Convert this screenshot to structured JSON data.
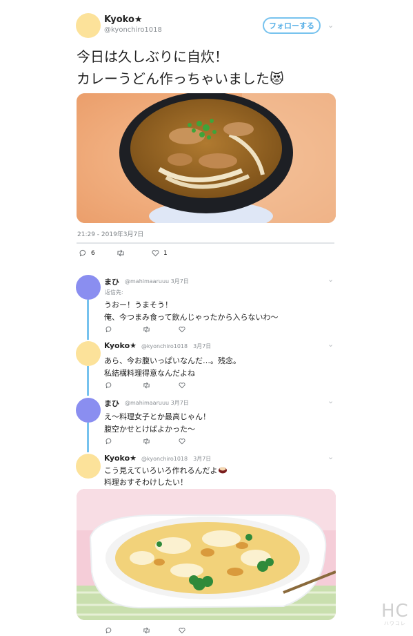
{
  "main_tweet": {
    "user_name": "Kyoko★",
    "handle": "@kyonchiro1018",
    "follow_label": "フォローする",
    "text_line1": "今日は久しぶりに自炊！",
    "text_line2": "カレーうどん作っちゃいました",
    "emoji": "😻",
    "timestamp": "21:29 - 2019年3月7日",
    "reply_count": "6",
    "like_count": "1"
  },
  "replies": [
    {
      "user_name": "まひ",
      "handle": "@mahimaaruuu 3月7日",
      "reply_to": "返信先:",
      "line1": "うおー！うまそう！",
      "line2": "俺、今つまみ食って飲んじゃったから入らないわ〜"
    },
    {
      "user_name": "Kyoko★",
      "handle": "@kyonchiro1018　3月7日",
      "line1": "あら、今お腹いっぱいなんだ…。残念。",
      "line2": "私結構料理得意なんだよね"
    },
    {
      "user_name": "まひ",
      "handle": "@mahimaaruuu 3月7日",
      "line1": "え〜料理女子とか最高じゃん！",
      "line2": "腹空かせとけばよかった〜"
    },
    {
      "user_name": "Kyoko★",
      "handle": "@kyonchiro1018　3月7日",
      "line1": "こう見えていろいろ作れるんだよ",
      "line2": "料理おすそわけしたい！"
    }
  ],
  "watermark": {
    "big": "HC",
    "small": "ハウコレ"
  },
  "colors": {
    "accent": "#76c2ee",
    "avatar_yellow": "#fce29a",
    "avatar_blue": "#8a8ef0"
  }
}
